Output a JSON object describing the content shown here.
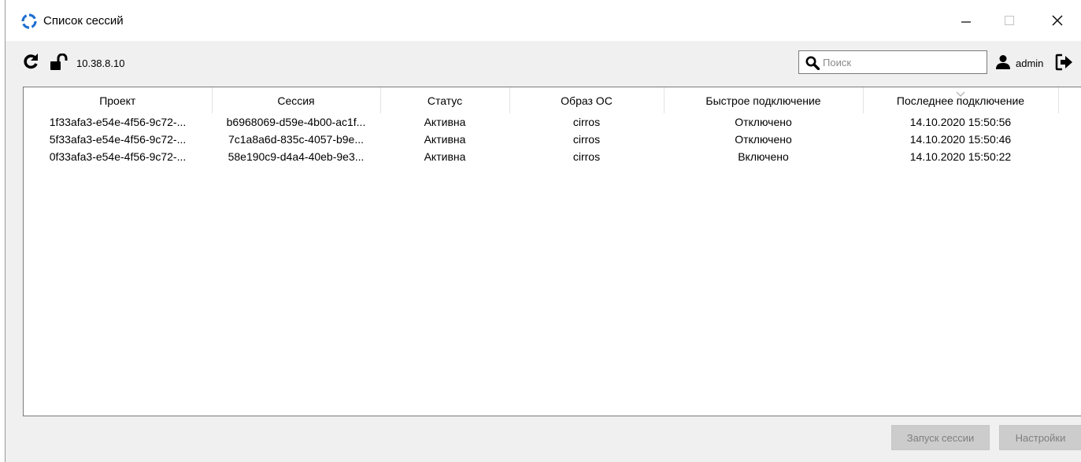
{
  "window": {
    "title": "Список сессий",
    "icons": {
      "app": "refresh-circle-icon",
      "minimize": "minimize-icon",
      "maximize": "maximize-icon",
      "close": "close-icon"
    }
  },
  "toolbar": {
    "server_address": "10.38.8.10",
    "search_placeholder": "Поиск",
    "search_value": "",
    "username": "admin",
    "icons": {
      "refresh": "refresh-icon",
      "lock": "unlock-icon",
      "search": "search-icon",
      "user": "user-icon",
      "logout": "logout-icon"
    }
  },
  "table": {
    "columns": [
      "Проект",
      "Сессия",
      "Статус",
      "Образ ОС",
      "Быстрое подключение",
      "Последнее подключение"
    ],
    "sorted_column": "Последнее подключение",
    "rows": [
      [
        "1f33afa3-e54e-4f56-9c72-...",
        "b6968069-d59e-4b00-ac1f...",
        "Активна",
        "cirros",
        "Отключено",
        "14.10.2020 15:50:56"
      ],
      [
        "5f33afa3-e54e-4f56-9c72-...",
        "7c1a8a6d-835c-4057-b9e...",
        "Активна",
        "cirros",
        "Отключено",
        "14.10.2020 15:50:46"
      ],
      [
        "0f33afa3-e54e-4f56-9c72-...",
        "58e190c9-d4a4-40eb-9e3...",
        "Активна",
        "cirros",
        "Включено",
        "14.10.2020 15:50:22"
      ]
    ]
  },
  "buttons": {
    "launch_session": "Запуск сессии",
    "settings": "Настройки"
  },
  "colors": {
    "window_bg": "#f0f0f0",
    "disabled_button_bg": "#cccccc",
    "disabled_button_text": "#7f7f7f",
    "app_icon_blue": "#1e6fd0"
  }
}
